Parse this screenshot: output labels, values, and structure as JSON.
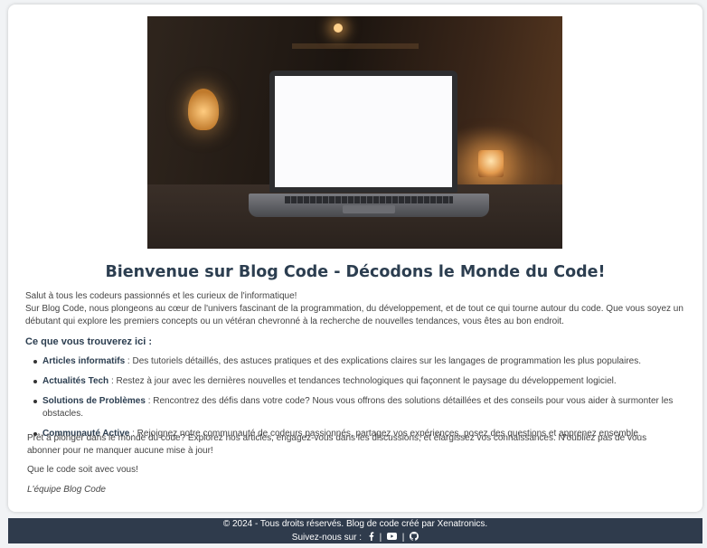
{
  "hero": {
    "image_alt": "laptop on desk in dim warm light"
  },
  "page_title": "Bienvenue sur Blog Code - Décodons le Monde du Code!",
  "intro": {
    "line1": "Salut à tous les codeurs passionnés et les curieux de l'informatique!",
    "line2": "Sur Blog Code, nous plongeons au cœur de l'univers fascinant de la programmation, du développement, et de tout ce qui tourne autour du code. Que vous soyez un débutant qui explore les premiers concepts ou un vétéran chevronné à la recherche de nouvelles tendances, vous êtes au bon endroit."
  },
  "section_heading": "Ce que vous trouverez ici :",
  "features": [
    {
      "title": "Articles informatifs",
      "text": " : Des tutoriels détaillés, des astuces pratiques et des explications claires sur les langages de programmation les plus populaires."
    },
    {
      "title": "Actualités Tech",
      "text": " : Restez à jour avec les dernières nouvelles et tendances technologiques qui façonnent le paysage du développement logiciel."
    },
    {
      "title": "Solutions de Problèmes",
      "text": " : Rencontrez des défis dans votre code? Nous vous offrons des solutions détaillées et des conseils pour vous aider à surmonter les obstacles."
    },
    {
      "title": "Communauté Active",
      "text": " : Rejoignez notre communauté de codeurs passionnés, partagez vos expériences, posez des questions et apprenez ensemble."
    }
  ],
  "outro": "Prêt à plonger dans le monde du code? Explorez nos articles, engagez-vous dans les discussions, et élargissez vos connaissances. N'oubliez pas de vous abonner pour ne manquer aucune mise à jour!",
  "signoff": "Que le code soit avec vous!",
  "signature": "L'équipe Blog Code",
  "footer": {
    "copyright": "© 2024 - Tous droits réservés. Blog de code créé par Xenatronics.",
    "follow": "Suivez-nous sur :",
    "separator": "|",
    "social_icons": [
      "facebook-icon",
      "youtube-icon",
      "github-icon"
    ]
  },
  "colors": {
    "heading": "#2c3e50",
    "footer_bg": "#2f3b4c",
    "page_bg": "#f1f3f5"
  }
}
